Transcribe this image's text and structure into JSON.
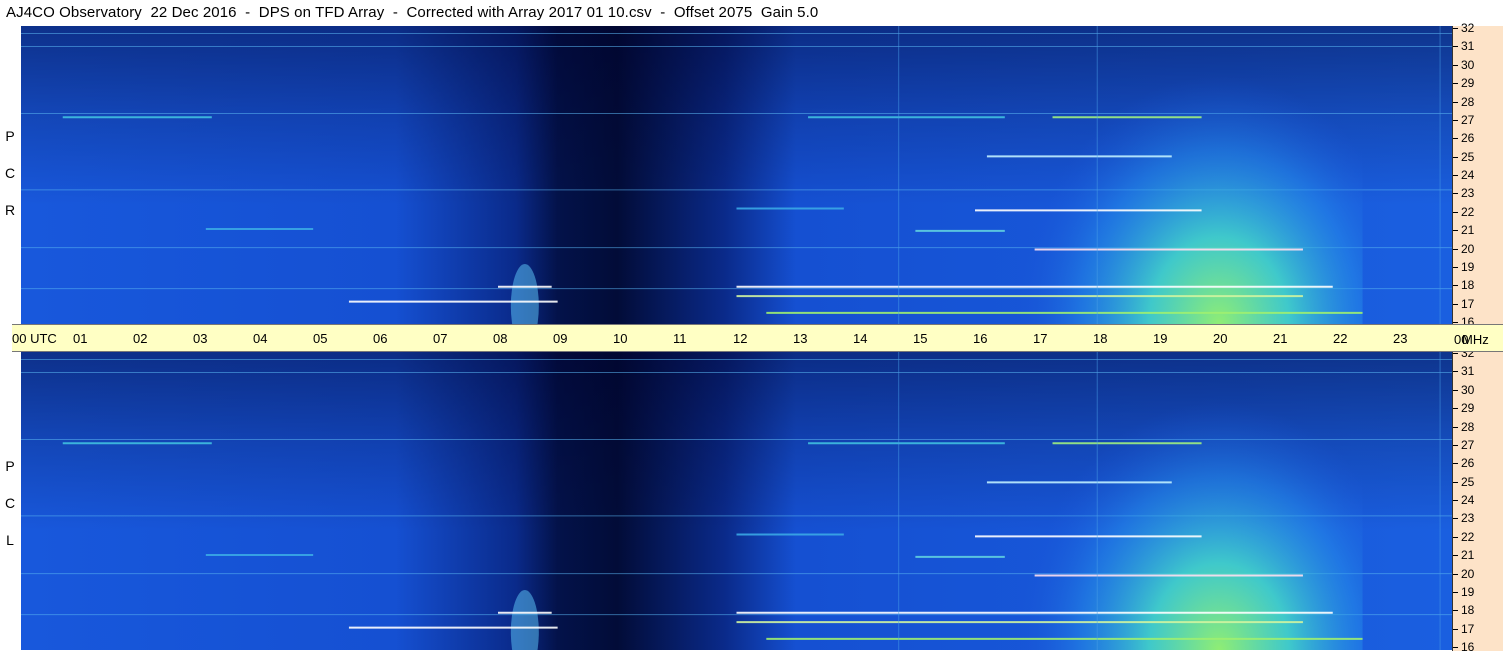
{
  "title": "AJ4CO Observatory  22 Dec 2016  -  DPS on TFD Array  -  Corrected with Array 2017 01 10.csv  -  Offset 2075  Gain 5.0",
  "top_panel_label": [
    "P",
    "C",
    "R"
  ],
  "bottom_panel_label": [
    "P",
    "C",
    "L"
  ],
  "time_axis": {
    "labels": [
      "00 UTC",
      "01",
      "02",
      "03",
      "04",
      "05",
      "06",
      "07",
      "08",
      "09",
      "10",
      "11",
      "12",
      "13",
      "14",
      "15",
      "16",
      "17",
      "18",
      "19",
      "20",
      "21",
      "22",
      "23"
    ],
    "end_label": "00",
    "unit": "MHz"
  },
  "freq_axis": {
    "ticks": [
      "32",
      "31",
      "30",
      "29",
      "28",
      "27",
      "26",
      "25",
      "24",
      "23",
      "22",
      "21",
      "20",
      "19",
      "18",
      "17",
      "16"
    ]
  },
  "colors": {
    "background_blue": "#1650d8",
    "dark_blue": "#000a30",
    "cyan": "#2fd0e6",
    "green": "#90f070",
    "axis_bg": "#fde3c8",
    "time_bar_bg": "#ffffc4"
  },
  "chart_data": [
    {
      "type": "heatmap",
      "name": "RCP",
      "title": "",
      "xlabel": "UTC",
      "ylabel": "MHz",
      "xlim": [
        0,
        24
      ],
      "ylim": [
        16,
        32
      ],
      "features": {
        "dark_region_utc": [
          7,
          13
        ],
        "bright_region_utc": [
          12,
          22.5
        ],
        "peak_brightness_utc": 18.5
      }
    },
    {
      "type": "heatmap",
      "name": "LCP",
      "title": "",
      "xlabel": "UTC",
      "ylabel": "MHz",
      "xlim": [
        0,
        24
      ],
      "ylim": [
        16,
        32
      ],
      "features": {
        "dark_region_utc": [
          7,
          13
        ],
        "bright_region_utc": [
          12,
          22.5
        ],
        "peak_brightness_utc": 18.5
      }
    }
  ]
}
